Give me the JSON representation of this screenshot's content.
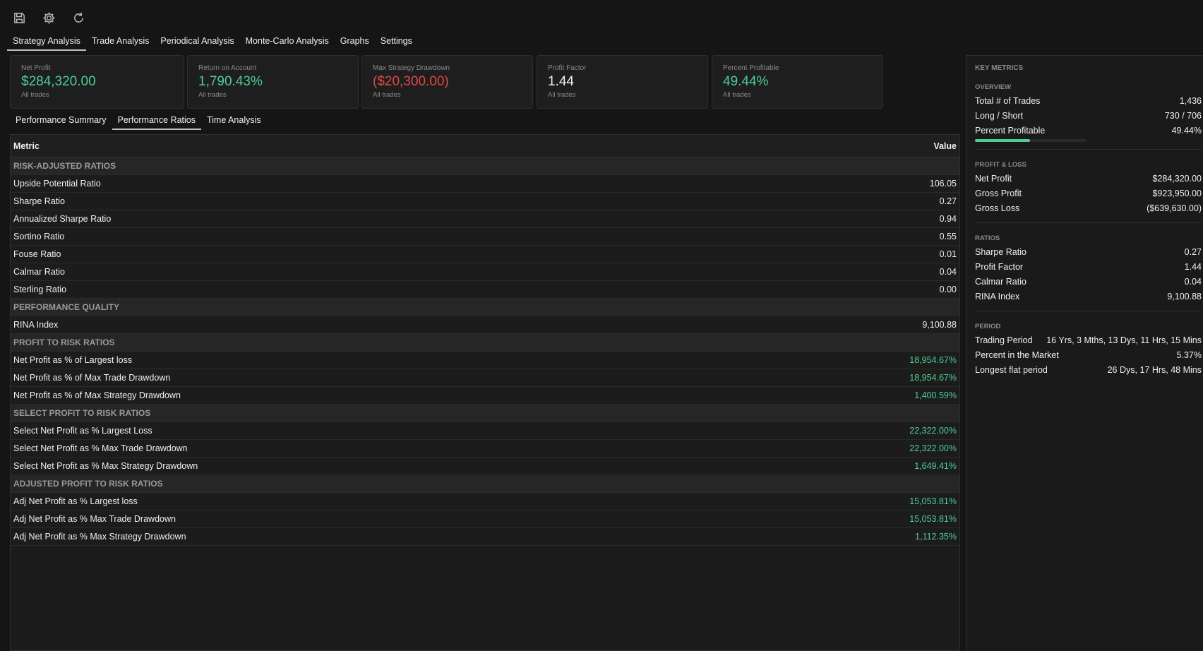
{
  "toolbar": {
    "icons": [
      "save-icon",
      "gear-icon",
      "refresh-icon"
    ]
  },
  "main_tabs": [
    {
      "label": "Strategy Analysis",
      "active": true
    },
    {
      "label": "Trade Analysis"
    },
    {
      "label": "Periodical Analysis"
    },
    {
      "label": "Monte-Carlo Analysis"
    },
    {
      "label": "Graphs"
    },
    {
      "label": "Settings"
    }
  ],
  "cards": [
    {
      "label": "Net Profit",
      "value": "$284,320.00",
      "sub": "All trades",
      "color": "#4ccf94"
    },
    {
      "label": "Return on Account",
      "value": "1,790.43%",
      "sub": "All trades",
      "color": "#4ccf94"
    },
    {
      "label": "Max Strategy Drawdown",
      "value": "($20,300.00)",
      "sub": "All trades",
      "color": "#e04848"
    },
    {
      "label": "Profit Factor",
      "value": "1.44",
      "sub": "All trades",
      "color": "#f0f0f0"
    },
    {
      "label": "Percent Profitable",
      "value": "49.44%",
      "sub": "All trades",
      "color": "#4ccf94"
    }
  ],
  "sub_tabs": [
    {
      "label": "Performance Summary"
    },
    {
      "label": "Performance Ratios",
      "active": true
    },
    {
      "label": "Time Analysis"
    }
  ],
  "table": {
    "header_metric": "Metric",
    "header_value": "Value",
    "rows": [
      {
        "section": "RISK-ADJUSTED RATIOS"
      },
      {
        "metric": "Upside Potential Ratio",
        "value": "106.05"
      },
      {
        "metric": "Sharpe Ratio",
        "value": "0.27"
      },
      {
        "metric": "Annualized Sharpe Ratio",
        "value": "0.94"
      },
      {
        "metric": "Sortino Ratio",
        "value": "0.55"
      },
      {
        "metric": "Fouse Ratio",
        "value": "0.01"
      },
      {
        "metric": "Calmar Ratio",
        "value": "0.04"
      },
      {
        "metric": "Sterling Ratio",
        "value": "0.00"
      },
      {
        "section": "PERFORMANCE QUALITY"
      },
      {
        "metric": "RINA Index",
        "value": "9,100.88"
      },
      {
        "section": "PROFIT TO RISK RATIOS"
      },
      {
        "metric": "Net Profit as % of Largest loss",
        "value": "18,954.67%",
        "tone": "pos"
      },
      {
        "metric": "Net Profit as % of Max Trade Drawdown",
        "value": "18,954.67%",
        "tone": "pos"
      },
      {
        "metric": "Net Profit as % of Max Strategy Drawdown",
        "value": "1,400.59%",
        "tone": "pos"
      },
      {
        "section": "SELECT PROFIT TO RISK RATIOS"
      },
      {
        "metric": "Select Net Profit  as % Largest Loss",
        "value": "22,322.00%",
        "tone": "pos"
      },
      {
        "metric": "Select Net Profit as % Max Trade Drawdown",
        "value": "22,322.00%",
        "tone": "pos"
      },
      {
        "metric": "Select Net Profit as % Max Strategy Drawdown",
        "value": "1,649.41%",
        "tone": "pos"
      },
      {
        "section": "ADJUSTED PROFIT TO RISK RATIOS"
      },
      {
        "metric": "Adj Net Profit as % Largest loss",
        "value": "15,053.81%",
        "tone": "pos"
      },
      {
        "metric": "Adj Net Profit as % Max Trade Drawdown",
        "value": "15,053.81%",
        "tone": "pos"
      },
      {
        "metric": "Adj Net Profit as % Max Strategy Drawdown",
        "value": "1,112.35%",
        "tone": "pos"
      }
    ]
  },
  "key_metrics": {
    "title": "KEY METRICS",
    "sections": [
      {
        "head": "OVERVIEW",
        "rows": [
          {
            "k": "Total # of Trades",
            "v": "1,436"
          },
          {
            "k": "Long / Short",
            "v": "730 / 706"
          },
          {
            "k": "Percent Profitable",
            "v": "49.44%",
            "tone": "pos",
            "bar": 0.4944
          }
        ]
      },
      {
        "head": "PROFIT & LOSS",
        "rows": [
          {
            "k": "Net Profit",
            "v": "$284,320.00",
            "tone": "pos"
          },
          {
            "k": "Gross Profit",
            "v": "$923,950.00",
            "tone": "pos"
          },
          {
            "k": "Gross Loss",
            "v": "($639,630.00)",
            "tone": "neg"
          }
        ]
      },
      {
        "head": "RATIOS",
        "rows": [
          {
            "k": "Sharpe Ratio",
            "v": "0.27"
          },
          {
            "k": "Profit Factor",
            "v": "1.44"
          },
          {
            "k": "Calmar Ratio",
            "v": "0.04"
          },
          {
            "k": "RINA Index",
            "v": "9,100.88"
          }
        ]
      },
      {
        "head": "PERIOD",
        "rows": [
          {
            "k": "Trading Period",
            "v": "16 Yrs, 3 Mths, 13 Dys, 11 Hrs, 15 Mins"
          },
          {
            "k": "Percent in the Market",
            "v": "5.37%",
            "tone": "pos"
          },
          {
            "k": "Longest flat period",
            "v": "26 Dys, 17 Hrs, 48 Mins"
          }
        ]
      }
    ]
  }
}
